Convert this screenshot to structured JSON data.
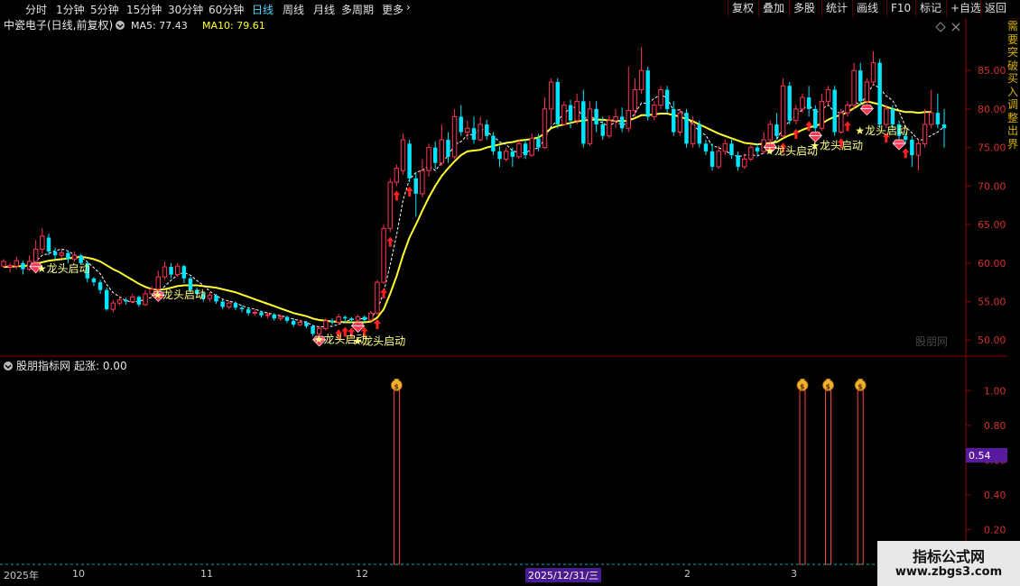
{
  "toolbar": {
    "left": [
      {
        "label": "分时"
      },
      {
        "label": "1分钟"
      },
      {
        "label": "5分钟"
      },
      {
        "label": "15分钟"
      },
      {
        "label": "30分钟"
      },
      {
        "label": "60分钟"
      },
      {
        "label": "日线",
        "active": true
      },
      {
        "label": "周线"
      },
      {
        "label": "月线"
      },
      {
        "label": "多周期"
      },
      {
        "label": "更多"
      }
    ],
    "right": [
      {
        "label": "复权"
      },
      {
        "label": "叠加"
      },
      {
        "label": "多股"
      },
      {
        "label": "统计"
      },
      {
        "label": "画线"
      },
      {
        "label": "F10"
      },
      {
        "label": "标记"
      },
      {
        "label": "+自选"
      },
      {
        "label": "返回"
      }
    ]
  },
  "header": {
    "title": "中瓷电子(日线,前复权)",
    "ma5_label": "MA5: 77.43",
    "ma10_label": "MA10: 79.61"
  },
  "main_watermark": "股朋网",
  "sub_header": {
    "title": "股朋指标网",
    "value_label": "起涨: 0.00"
  },
  "sub_cursor_value": "0.54",
  "date_labels": [
    "2025年",
    "10",
    "11",
    "12",
    "2025/12/31/三",
    "2",
    "3"
  ],
  "side_text": "需要突破买入调整出界",
  "site_watermark": {
    "line1": "指标公式网",
    "line2": "www.zbgs3.com"
  },
  "signal_label": "★龙头启动",
  "colors": {
    "up": "#ff3355",
    "down": "#00e5ff",
    "ma5": "#ffffff",
    "ma10": "#ffff30",
    "axis": "#8a0000",
    "text": "#ffff80"
  },
  "chart_data": [
    {
      "type": "candlestick",
      "title": "中瓷电子(日线,前复权)",
      "y_ticks": [
        50,
        55,
        60,
        65,
        70,
        75,
        80,
        85
      ],
      "ylim": [
        48.5,
        89
      ],
      "candles": [
        [
          59.6,
          60.2,
          59.3,
          60.5
        ],
        [
          59.5,
          59.7,
          58.8,
          60.0
        ],
        [
          59.6,
          60.3,
          59.2,
          60.8
        ],
        [
          60.0,
          59.2,
          58.5,
          60.3
        ],
        [
          59.2,
          60.2,
          59.0,
          61.0
        ],
        [
          60.2,
          61.8,
          60.0,
          63.0
        ],
        [
          61.8,
          63.5,
          61.2,
          64.5
        ],
        [
          63.3,
          61.5,
          61.0,
          63.8
        ],
        [
          61.5,
          61.0,
          60.5,
          62.0
        ],
        [
          61.0,
          61.3,
          60.6,
          61.8
        ],
        [
          61.3,
          60.5,
          60.0,
          61.6
        ],
        [
          60.5,
          61.0,
          60.2,
          61.5
        ],
        [
          61.0,
          60.0,
          59.8,
          61.2
        ],
        [
          60.0,
          58.0,
          57.5,
          60.2
        ],
        [
          58.0,
          57.5,
          57.0,
          58.2
        ],
        [
          57.5,
          56.5,
          56.0,
          57.8
        ],
        [
          56.5,
          54.0,
          53.8,
          56.8
        ],
        [
          54.0,
          54.8,
          53.6,
          55.2
        ],
        [
          54.8,
          55.2,
          54.5,
          55.6
        ],
        [
          55.2,
          55.0,
          54.6,
          55.5
        ],
        [
          55.0,
          55.6,
          54.8,
          56.0
        ],
        [
          55.6,
          54.6,
          54.3,
          55.8
        ],
        [
          54.6,
          56.0,
          54.4,
          56.5
        ],
        [
          56.0,
          56.6,
          55.6,
          57.0
        ],
        [
          56.6,
          58.2,
          56.3,
          59.0
        ],
        [
          58.2,
          59.5,
          57.8,
          60.2
        ],
        [
          59.5,
          58.5,
          58.0,
          60.0
        ],
        [
          58.5,
          59.6,
          58.2,
          60.0
        ],
        [
          59.6,
          58.0,
          57.4,
          59.8
        ],
        [
          58.0,
          56.5,
          56.0,
          58.2
        ],
        [
          56.5,
          56.0,
          55.6,
          56.8
        ],
        [
          56.0,
          55.4,
          55.0,
          56.2
        ],
        [
          55.4,
          55.8,
          55.0,
          56.2
        ],
        [
          55.8,
          55.0,
          54.7,
          56.0
        ],
        [
          55.0,
          54.3,
          54.0,
          55.3
        ],
        [
          54.3,
          54.8,
          54.0,
          55.1
        ],
        [
          54.8,
          54.2,
          53.9,
          55.0
        ],
        [
          54.2,
          54.0,
          53.6,
          54.5
        ],
        [
          54.0,
          53.5,
          53.2,
          54.2
        ],
        [
          53.5,
          53.6,
          53.2,
          54.0
        ],
        [
          53.6,
          53.2,
          52.9,
          53.8
        ],
        [
          53.2,
          53.3,
          52.8,
          53.6
        ],
        [
          53.3,
          52.8,
          52.5,
          53.5
        ],
        [
          52.8,
          53.0,
          52.5,
          53.3
        ],
        [
          53.0,
          52.5,
          52.2,
          53.2
        ],
        [
          52.5,
          52.0,
          51.7,
          52.8
        ],
        [
          52.0,
          52.3,
          51.8,
          52.6
        ],
        [
          52.3,
          51.8,
          51.5,
          52.5
        ],
        [
          51.8,
          50.8,
          50.5,
          52.0
        ],
        [
          50.8,
          51.5,
          50.5,
          51.8
        ],
        [
          51.5,
          52.5,
          51.2,
          52.8
        ],
        [
          52.5,
          52.3,
          52.0,
          52.8
        ],
        [
          52.3,
          53.0,
          52.0,
          53.4
        ],
        [
          53.0,
          52.8,
          52.3,
          53.2
        ],
        [
          52.8,
          52.6,
          52.2,
          53.0
        ],
        [
          52.6,
          53.0,
          52.3,
          53.3
        ],
        [
          53.0,
          52.6,
          52.3,
          53.2
        ],
        [
          52.6,
          53.5,
          52.4,
          53.8
        ],
        [
          53.5,
          57.5,
          53.3,
          57.8
        ],
        [
          57.5,
          64.5,
          57.3,
          65.0
        ],
        [
          64.5,
          70.5,
          64.0,
          71.0
        ],
        [
          70.5,
          72.3,
          70.0,
          72.8
        ],
        [
          72.0,
          76.0,
          71.5,
          76.8
        ],
        [
          75.5,
          71.0,
          70.5,
          76.0
        ],
        [
          71.0,
          69.0,
          66.0,
          71.8
        ],
        [
          69.0,
          72.0,
          68.5,
          73.5
        ],
        [
          72.0,
          75.0,
          71.2,
          75.5
        ],
        [
          75.0,
          73.0,
          72.2,
          75.8
        ],
        [
          73.0,
          76.0,
          72.6,
          78.0
        ],
        [
          76.0,
          73.8,
          73.0,
          77.0
        ],
        [
          73.8,
          79.0,
          73.5,
          80.0
        ],
        [
          79.0,
          77.0,
          76.5,
          80.5
        ],
        [
          77.0,
          77.5,
          76.0,
          78.5
        ],
        [
          77.5,
          76.0,
          75.5,
          79.0
        ],
        [
          76.0,
          78.0,
          75.8,
          79.0
        ],
        [
          78.0,
          76.5,
          76.0,
          78.6
        ],
        [
          76.5,
          74.5,
          74.0,
          77.0
        ],
        [
          74.5,
          73.5,
          72.5,
          75.2
        ],
        [
          73.5,
          74.5,
          73.2,
          75.0
        ],
        [
          74.5,
          73.8,
          72.5,
          75.0
        ],
        [
          73.8,
          75.5,
          73.5,
          76.0
        ],
        [
          75.5,
          74.0,
          73.5,
          76.0
        ],
        [
          74.0,
          76.2,
          73.8,
          76.8
        ],
        [
          76.2,
          75.0,
          74.5,
          76.8
        ],
        [
          75.0,
          80.0,
          74.8,
          81.5
        ],
        [
          80.0,
          83.5,
          78.0,
          84.0
        ],
        [
          83.5,
          78.0,
          77.5,
          84.0
        ],
        [
          78.0,
          80.5,
          77.8,
          81.0
        ],
        [
          80.5,
          78.5,
          77.5,
          81.2
        ],
        [
          78.5,
          81.0,
          78.0,
          82.0
        ],
        [
          81.0,
          75.5,
          75.0,
          82.5
        ],
        [
          75.5,
          80.0,
          75.2,
          81.0
        ],
        [
          80.0,
          78.0,
          77.0,
          81.0
        ],
        [
          78.0,
          76.5,
          76.0,
          79.0
        ],
        [
          76.5,
          78.5,
          76.2,
          79.2
        ],
        [
          78.5,
          79.0,
          77.5,
          80.0
        ],
        [
          79.0,
          77.5,
          77.0,
          80.2
        ],
        [
          77.5,
          79.8,
          77.0,
          85.5
        ],
        [
          79.8,
          82.5,
          79.0,
          84.0
        ],
        [
          82.5,
          85.0,
          82.0,
          88.0
        ],
        [
          85.0,
          79.0,
          78.5,
          85.5
        ],
        [
          79.0,
          80.5,
          78.5,
          81.0
        ],
        [
          80.5,
          82.5,
          80.0,
          83.0
        ],
        [
          82.5,
          80.0,
          79.5,
          83.0
        ],
        [
          80.0,
          77.0,
          76.5,
          81.0
        ],
        [
          77.0,
          79.5,
          76.5,
          80.0
        ],
        [
          79.5,
          75.5,
          75.0,
          80.0
        ],
        [
          75.5,
          78.0,
          75.0,
          79.0
        ],
        [
          78.0,
          75.5,
          75.0,
          78.5
        ],
        [
          75.5,
          74.5,
          74.0,
          76.0
        ],
        [
          74.5,
          72.5,
          72.0,
          75.5
        ],
        [
          72.5,
          74.5,
          72.2,
          75.2
        ],
        [
          74.5,
          75.5,
          74.0,
          76.0
        ],
        [
          75.5,
          74.0,
          73.5,
          76.0
        ],
        [
          74.0,
          72.5,
          72.0,
          74.5
        ],
        [
          72.5,
          73.5,
          72.2,
          74.2
        ],
        [
          73.5,
          75.0,
          73.2,
          75.5
        ],
        [
          75.0,
          74.5,
          74.0,
          75.5
        ],
        [
          74.5,
          76.0,
          74.2,
          77.0
        ],
        [
          76.0,
          78.0,
          75.5,
          78.5
        ],
        [
          78.0,
          76.5,
          76.0,
          79.5
        ],
        [
          76.5,
          83.0,
          76.2,
          84.0
        ],
        [
          83.0,
          78.5,
          78.0,
          83.5
        ],
        [
          78.5,
          80.0,
          78.0,
          80.5
        ],
        [
          80.0,
          81.5,
          79.5,
          82.0
        ],
        [
          81.5,
          80.0,
          79.0,
          83.0
        ],
        [
          80.0,
          77.5,
          77.0,
          80.5
        ],
        [
          77.5,
          81.0,
          77.2,
          82.0
        ],
        [
          81.0,
          82.5,
          80.5,
          83.0
        ],
        [
          82.5,
          77.0,
          76.5,
          83.0
        ],
        [
          77.0,
          79.5,
          76.8,
          80.0
        ],
        [
          79.5,
          80.5,
          79.0,
          81.0
        ],
        [
          80.5,
          85.0,
          80.0,
          86.0
        ],
        [
          85.0,
          81.0,
          80.5,
          86.0
        ],
        [
          81.0,
          83.5,
          80.5,
          84.0
        ],
        [
          83.5,
          86.0,
          83.0,
          87.5
        ],
        [
          86.0,
          78.0,
          77.5,
          86.5
        ],
        [
          78.0,
          80.0,
          77.5,
          80.5
        ],
        [
          80.0,
          78.0,
          77.0,
          80.5
        ],
        [
          78.0,
          76.5,
          76.0,
          78.5
        ],
        [
          76.5,
          76.0,
          75.5,
          77.0
        ],
        [
          76.0,
          74.0,
          72.5,
          76.5
        ],
        [
          74.0,
          75.5,
          72.0,
          76.0
        ],
        [
          75.5,
          78.0,
          75.0,
          80.0
        ],
        [
          78.0,
          79.5,
          77.5,
          82.5
        ],
        [
          79.5,
          78.0,
          77.5,
          82.0
        ],
        [
          78.0,
          77.5,
          75.0,
          80.0
        ]
      ],
      "ma10": [
        59.5,
        59.5,
        59.6,
        59.6,
        59.7,
        59.9,
        60.1,
        60.3,
        60.4,
        60.5,
        60.6,
        60.7,
        60.8,
        60.7,
        60.5,
        60.2,
        59.7,
        59.2,
        58.8,
        58.3,
        57.8,
        57.3,
        56.9,
        56.6,
        56.5,
        56.6,
        56.8,
        57.0,
        57.1,
        57.1,
        57.1,
        57.0,
        56.9,
        56.8,
        56.6,
        56.4,
        56.2,
        55.9,
        55.6,
        55.3,
        55.0,
        54.7,
        54.4,
        54.1,
        53.8,
        53.5,
        53.3,
        53.1,
        52.8,
        52.6,
        52.5,
        52.4,
        52.4,
        52.3,
        52.3,
        52.3,
        52.3,
        52.4,
        52.9,
        54.0,
        56.0,
        58.3,
        61.0,
        63.3,
        65.0,
        66.8,
        68.5,
        70.0,
        71.3,
        72.3,
        73.2,
        74.0,
        74.5,
        74.6,
        74.7,
        75.0,
        75.2,
        75.4,
        75.6,
        75.7,
        75.9,
        76.0,
        76.1,
        76.3,
        76.8,
        77.5,
        77.8,
        78.0,
        78.2,
        78.4,
        78.5,
        78.6,
        78.6,
        78.6,
        78.5,
        78.5,
        78.4,
        78.5,
        78.8,
        79.2,
        79.2,
        79.3,
        79.4,
        79.4,
        79.2,
        79.0,
        78.7,
        78.4,
        78.0,
        77.6,
        77.2,
        76.8,
        76.5,
        76.2,
        75.9,
        75.6,
        75.5,
        75.4,
        75.5,
        75.6,
        75.7,
        76.2,
        76.6,
        76.9,
        77.3,
        77.6,
        77.8,
        78.1,
        78.6,
        79.0,
        79.2,
        79.6,
        80.1,
        80.6,
        81.0,
        80.8,
        80.6,
        80.3,
        80.0,
        79.8,
        79.6,
        79.6,
        79.5,
        79.6,
        79.6
      ],
      "ma5_from_index": 28,
      "buy_arrows": [
        52,
        53,
        54,
        56,
        58,
        59,
        60,
        61,
        63,
        121,
        123,
        125,
        130,
        131,
        137,
        140
      ],
      "gem_markers": [
        5,
        24,
        49,
        55,
        119,
        126,
        134,
        139
      ],
      "signals": [
        {
          "x_index": 6,
          "y_value": 58.8
        },
        {
          "x_index": 24,
          "y_value": 55.4
        },
        {
          "x_index": 49,
          "y_value": 49.6
        },
        {
          "x_index": 55,
          "y_value": 49.4
        },
        {
          "x_index": 119,
          "y_value": 74.1
        },
        {
          "x_index": 126,
          "y_value": 74.8
        },
        {
          "x_index": 133,
          "y_value": 76.7
        }
      ]
    },
    {
      "type": "bar",
      "title": "股朋指标网",
      "y_ticks": [
        0.2,
        0.4,
        0.6,
        0.8,
        1.0
      ],
      "ylim": [
        0,
        1.1
      ],
      "spikes": [
        {
          "x_index": 61,
          "value": 1.0
        },
        {
          "x_index": 124,
          "value": 1.0
        },
        {
          "x_index": 128,
          "value": 1.0
        },
        {
          "x_index": 133,
          "value": 1.0
        }
      ]
    }
  ]
}
